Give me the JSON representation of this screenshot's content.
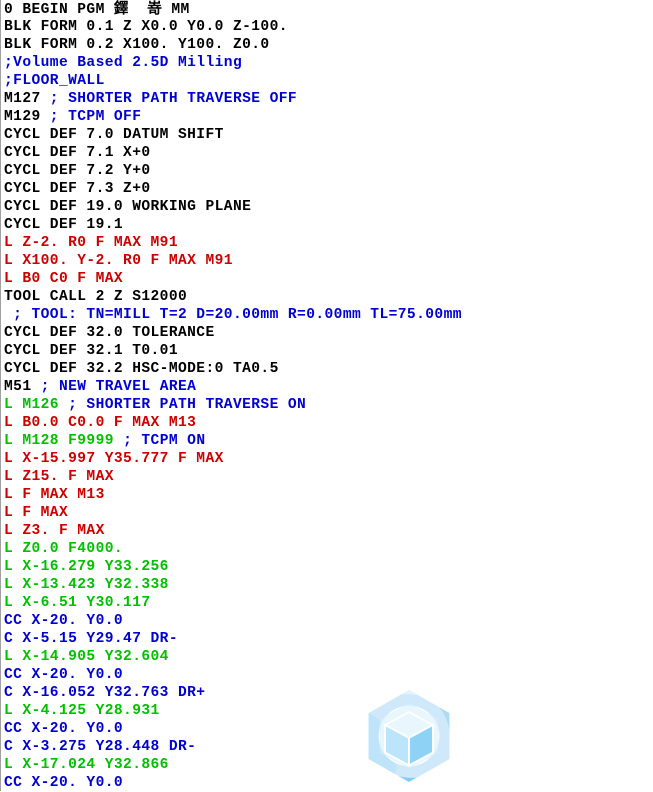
{
  "editor": {
    "font_size_px": 14.6,
    "line_height_px": 18,
    "background": "#ffffff",
    "gutter_border_color": "#a0a0a0",
    "colors": {
      "standard_block": "#000000",
      "comment": "#0000d0",
      "rapid_move": "#cc0000",
      "feed_move": "#00c000"
    }
  },
  "watermark": {
    "name": "hexagon-cube-logo",
    "colors": {
      "hex_light": "#cfe9fa",
      "hex_mid": "#aedcf6",
      "hex_dark": "#6cc5ef",
      "cube_light": "#eaf6fd",
      "cube_mid": "#cbe9fa",
      "cube_dark": "#9ed7f5"
    }
  },
  "program": {
    "lines": [
      {
        "segments": [
          {
            "text": "0 BEGIN PGM ",
            "color": "black"
          },
          {
            "text": "鐸",
            "color": "black",
            "cjk": true
          },
          {
            "text": "  ",
            "color": "black"
          },
          {
            "text": "嵜",
            "color": "black",
            "cjk": true
          },
          {
            "text": " MM",
            "color": "black"
          }
        ]
      },
      {
        "segments": [
          {
            "text": "BLK FORM 0.1 Z X0.0 Y0.0 Z-100.",
            "color": "black"
          }
        ]
      },
      {
        "segments": [
          {
            "text": "BLK FORM 0.2 X100. Y100. Z0.0",
            "color": "black"
          }
        ]
      },
      {
        "segments": [
          {
            "text": ";Volume Based 2.5D Milling",
            "color": "blue"
          }
        ]
      },
      {
        "segments": [
          {
            "text": ";FLOOR_WALL",
            "color": "blue"
          }
        ]
      },
      {
        "segments": [
          {
            "text": "M127 ",
            "color": "black"
          },
          {
            "text": "; SHORTER PATH TRAVERSE OFF",
            "color": "blue"
          }
        ]
      },
      {
        "segments": [
          {
            "text": "M129 ",
            "color": "black"
          },
          {
            "text": "; TCPM OFF",
            "color": "blue"
          }
        ]
      },
      {
        "segments": [
          {
            "text": "CYCL DEF 7.0 DATUM SHIFT",
            "color": "black"
          }
        ]
      },
      {
        "segments": [
          {
            "text": "CYCL DEF 7.1 X+0",
            "color": "black"
          }
        ]
      },
      {
        "segments": [
          {
            "text": "CYCL DEF 7.2 Y+0",
            "color": "black"
          }
        ]
      },
      {
        "segments": [
          {
            "text": "CYCL DEF 7.3 Z+0",
            "color": "black"
          }
        ]
      },
      {
        "segments": [
          {
            "text": "CYCL DEF 19.0 WORKING PLANE",
            "color": "black"
          }
        ]
      },
      {
        "segments": [
          {
            "text": "CYCL DEF 19.1",
            "color": "black"
          }
        ]
      },
      {
        "segments": [
          {
            "text": "L Z-2. R0 F MAX M91",
            "color": "red"
          }
        ]
      },
      {
        "segments": [
          {
            "text": "L X100. Y-2. R0 F MAX M91",
            "color": "red"
          }
        ]
      },
      {
        "segments": [
          {
            "text": "L B0 C0 F MAX",
            "color": "red"
          }
        ]
      },
      {
        "segments": [
          {
            "text": "TOOL CALL 2 Z S12000",
            "color": "black"
          }
        ]
      },
      {
        "segments": [
          {
            "text": " ; TOOL: TN=MILL T=2 D=20.00mm R=0.00mm TL=75.00mm",
            "color": "blue"
          }
        ]
      },
      {
        "segments": [
          {
            "text": "CYCL DEF 32.0 TOLERANCE",
            "color": "black"
          }
        ]
      },
      {
        "segments": [
          {
            "text": "CYCL DEF 32.1 T0.01",
            "color": "black"
          }
        ]
      },
      {
        "segments": [
          {
            "text": "CYCL DEF 32.2 HSC-MODE:0 TA0.5",
            "color": "black"
          }
        ]
      },
      {
        "segments": [
          {
            "text": "M51 ",
            "color": "black"
          },
          {
            "text": "; NEW TRAVEL AREA",
            "color": "blue"
          }
        ]
      },
      {
        "segments": [
          {
            "text": "L M126 ",
            "color": "green"
          },
          {
            "text": "; SHORTER PATH TRAVERSE ON",
            "color": "blue"
          }
        ]
      },
      {
        "segments": [
          {
            "text": "L B0.0 C0.0 F MAX M13",
            "color": "red"
          }
        ]
      },
      {
        "segments": [
          {
            "text": "L M128 F9999 ",
            "color": "green"
          },
          {
            "text": "; TCPM ON",
            "color": "blue"
          }
        ]
      },
      {
        "segments": [
          {
            "text": "L X-15.997 Y35.777 F MAX",
            "color": "red"
          }
        ]
      },
      {
        "segments": [
          {
            "text": "L Z15. F MAX",
            "color": "red"
          }
        ]
      },
      {
        "segments": [
          {
            "text": "L F MAX M13",
            "color": "red"
          }
        ]
      },
      {
        "segments": [
          {
            "text": "L F MAX",
            "color": "red"
          }
        ]
      },
      {
        "segments": [
          {
            "text": "L Z3. F MAX",
            "color": "red"
          }
        ]
      },
      {
        "segments": [
          {
            "text": "L Z0.0 F4000.",
            "color": "green"
          }
        ]
      },
      {
        "segments": [
          {
            "text": "L X-16.279 Y33.256",
            "color": "green"
          }
        ]
      },
      {
        "segments": [
          {
            "text": "L X-13.423 Y32.338",
            "color": "green"
          }
        ]
      },
      {
        "segments": [
          {
            "text": "L X-6.51 Y30.117",
            "color": "green"
          }
        ]
      },
      {
        "segments": [
          {
            "text": "CC X-20. Y0.0",
            "color": "blue"
          }
        ]
      },
      {
        "segments": [
          {
            "text": "C X-5.15 Y29.47 DR-",
            "color": "blue"
          }
        ]
      },
      {
        "segments": [
          {
            "text": "L X-14.905 Y32.604",
            "color": "green"
          }
        ]
      },
      {
        "segments": [
          {
            "text": "CC X-20. Y0.0",
            "color": "blue"
          }
        ]
      },
      {
        "segments": [
          {
            "text": "C X-16.052 Y32.763 DR+",
            "color": "blue"
          }
        ]
      },
      {
        "segments": [
          {
            "text": "L X-4.125 Y28.931",
            "color": "green"
          }
        ]
      },
      {
        "segments": [
          {
            "text": "CC X-20. Y0.0",
            "color": "blue"
          }
        ]
      },
      {
        "segments": [
          {
            "text": "C X-3.275 Y28.448 DR-",
            "color": "blue"
          }
        ]
      },
      {
        "segments": [
          {
            "text": "L X-17.024 Y32.866",
            "color": "green"
          }
        ]
      },
      {
        "segments": [
          {
            "text": "CC X-20. Y0.0",
            "color": "blue"
          }
        ]
      }
    ]
  }
}
